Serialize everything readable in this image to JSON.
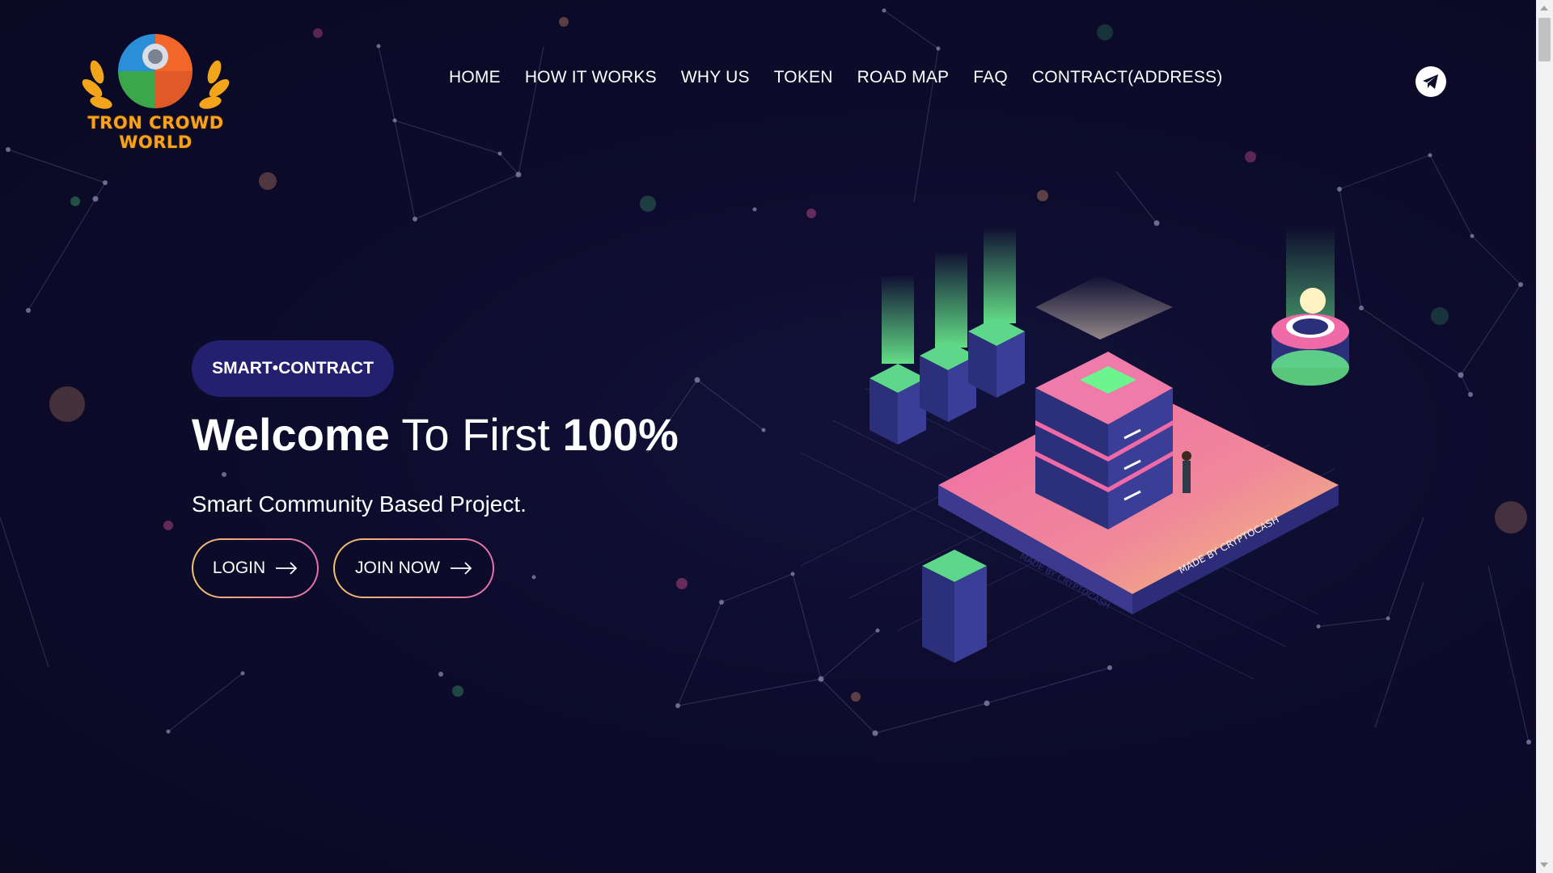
{
  "window": {
    "title": "Tron Crowd World"
  },
  "logo": {
    "text": "TRON CROWD WORLD",
    "icon": "crest-logo-icon"
  },
  "nav": {
    "items": [
      {
        "label": "HOME"
      },
      {
        "label": "HOW IT WORKS"
      },
      {
        "label": "WHY US"
      },
      {
        "label": "TOKEN"
      },
      {
        "label": "ROAD MAP"
      },
      {
        "label": "FAQ"
      },
      {
        "label": "CONTRACT(ADDRESS)"
      }
    ],
    "telegram_icon": "telegram-icon"
  },
  "hero": {
    "badge": "SMART•CONTRACT",
    "title_bold_1": "Welcome",
    "title_regular": " To First ",
    "title_bold_2": "100%",
    "subtitle": "Smart Community Based Project.",
    "login_label": "LOGIN",
    "join_label": "JOIN NOW",
    "arrow_icon": "arrow-right-icon"
  },
  "illustration": {
    "platform_text": "MADE BY CRYPTOCASH",
    "platform_text_2": "MADE BY CRYPTOCASH"
  },
  "colors": {
    "background": "#0c0b2a",
    "badge": "#232070",
    "button_border_start": "#f5c26b",
    "button_border_end": "#e66fb0",
    "logo_text": "#f7a21b",
    "accent_green": "#5ef28a",
    "accent_pink": "#e66fb0"
  }
}
